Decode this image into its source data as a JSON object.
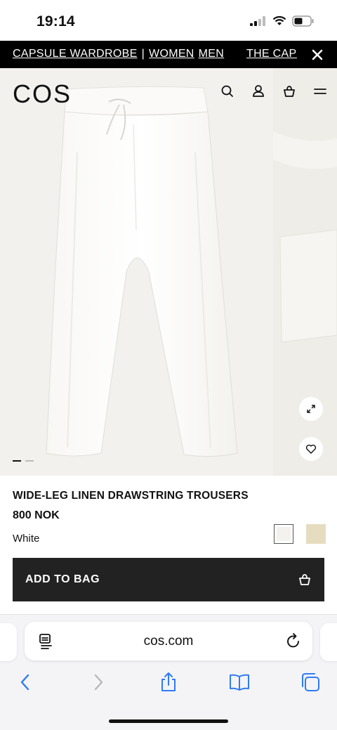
{
  "status_bar": {
    "time": "19:14"
  },
  "announcement": {
    "items": [
      "CAPSULE WARDROBE",
      "WOMEN",
      "MEN"
    ],
    "separator": "|",
    "repeat_text": "THE CAPSULE WARDROBE"
  },
  "header": {
    "logo": "COS",
    "icons": [
      "search-icon",
      "account-icon",
      "bag-icon",
      "menu-icon"
    ]
  },
  "gallery": {
    "image_count": 2,
    "active_index": 0
  },
  "product": {
    "title": "WIDE-LEG LINEN DRAWSTRING TROUSERS",
    "price": "800 NOK",
    "color_name": "White",
    "swatches": [
      {
        "name": "White",
        "color": "#f4f2ee",
        "selected": true
      },
      {
        "name": "Beige",
        "color": "#e6dcc0",
        "selected": false
      }
    ],
    "add_to_bag_label": "ADD TO BAG"
  },
  "browser": {
    "url": "cos.com"
  },
  "colors": {
    "announcement_bg": "#000000",
    "button_bg": "#222222",
    "accent_blue": "#2f7bf6"
  }
}
